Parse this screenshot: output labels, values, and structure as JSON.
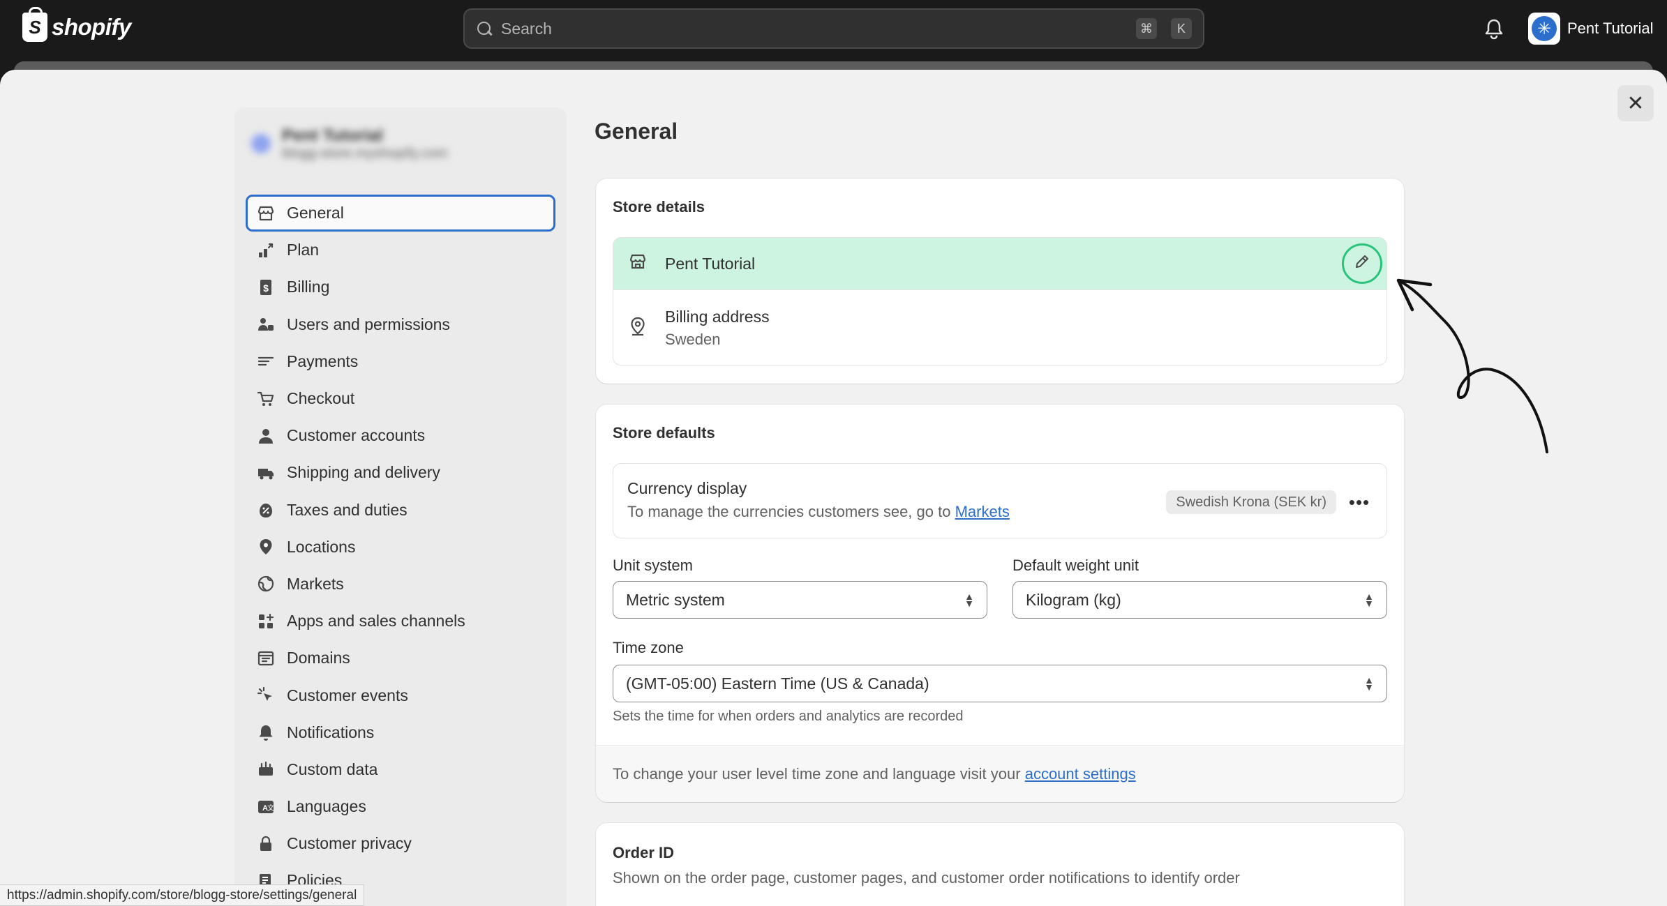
{
  "topbar": {
    "logo_text": "shopify",
    "search_placeholder": "Search",
    "shortcut_cmd": "⌘",
    "shortcut_key": "K",
    "user_name": "Pent Tutorial"
  },
  "sidebar": {
    "store_name": "Pent Tutorial",
    "store_domain": "blogg-store.myshopify.com",
    "items": [
      {
        "label": "General",
        "icon": "store-icon"
      },
      {
        "label": "Plan",
        "icon": "plan-icon"
      },
      {
        "label": "Billing",
        "icon": "billing-icon"
      },
      {
        "label": "Users and permissions",
        "icon": "users-icon"
      },
      {
        "label": "Payments",
        "icon": "payments-icon"
      },
      {
        "label": "Checkout",
        "icon": "cart-icon"
      },
      {
        "label": "Customer accounts",
        "icon": "person-icon"
      },
      {
        "label": "Shipping and delivery",
        "icon": "truck-icon"
      },
      {
        "label": "Taxes and duties",
        "icon": "tax-icon"
      },
      {
        "label": "Locations",
        "icon": "location-icon"
      },
      {
        "label": "Markets",
        "icon": "globe-icon"
      },
      {
        "label": "Apps and sales channels",
        "icon": "apps-icon"
      },
      {
        "label": "Domains",
        "icon": "domains-icon"
      },
      {
        "label": "Customer events",
        "icon": "cursor-icon"
      },
      {
        "label": "Notifications",
        "icon": "bell-icon"
      },
      {
        "label": "Custom data",
        "icon": "custom-data-icon"
      },
      {
        "label": "Languages",
        "icon": "languages-icon"
      },
      {
        "label": "Customer privacy",
        "icon": "lock-icon"
      },
      {
        "label": "Policies",
        "icon": "policies-icon"
      }
    ]
  },
  "status_url": "https://admin.shopify.com/store/blogg-store/settings/general",
  "main": {
    "page_title": "General",
    "store_details": {
      "title": "Store details",
      "store_name": "Pent Tutorial",
      "billing_label": "Billing address",
      "billing_value": "Sweden"
    },
    "store_defaults": {
      "title": "Store defaults",
      "currency_label": "Currency display",
      "currency_sub_prefix": "To manage the currencies customers see, go to ",
      "currency_link": "Markets",
      "currency_badge": "Swedish Krona (SEK kr)",
      "unit_label": "Unit system",
      "unit_value": "Metric system",
      "weight_label": "Default weight unit",
      "weight_value": "Kilogram (kg)",
      "timezone_label": "Time zone",
      "timezone_value": "(GMT-05:00) Eastern Time (US & Canada)",
      "timezone_help": "Sets the time for when orders and analytics are recorded",
      "footer_prefix": "To change your user level time zone and language visit your ",
      "footer_link": "account settings"
    },
    "order_id": {
      "title": "Order ID",
      "subtitle": "Shown on the order page, customer pages, and customer order notifications to identify order"
    }
  },
  "colors": {
    "topbar": "#1a1a1a",
    "highlight_row": "#cdf4e0",
    "highlight_ring": "#29c47a",
    "link": "#2c6ecb",
    "active_border": "#2c6ecb"
  }
}
